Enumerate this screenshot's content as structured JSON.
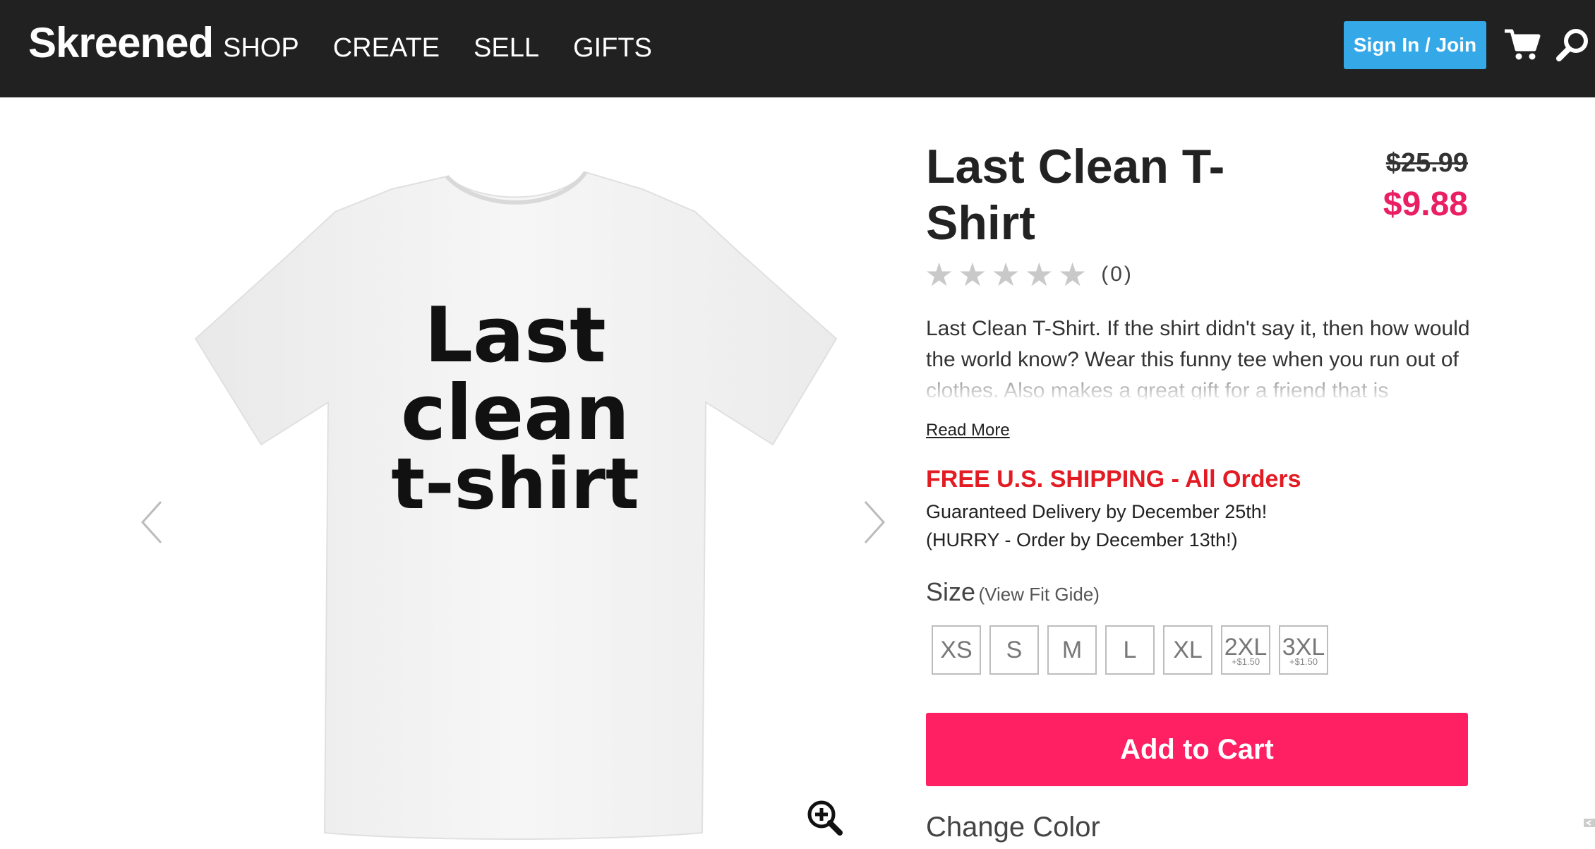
{
  "header": {
    "logo": "Skreened",
    "nav": [
      "SHOP",
      "CREATE",
      "SELL",
      "GIFTS"
    ],
    "signin_label": "Sign In / Join",
    "cart_icon": "cart-icon",
    "search_icon": "search-icon"
  },
  "product": {
    "shirt_text": [
      "Last",
      "clean",
      "t-shirt"
    ],
    "title": "Last Clean T-Shirt",
    "price_old": "$25.99",
    "price_new": "$9.88",
    "rating": {
      "stars": 0,
      "max": 5,
      "count_label": "(0)"
    },
    "description": "Last Clean T-Shirt. If the shirt didn't say it, then how would the world know? Wear this funny tee when you run out of clothes. Also makes a great gift for a friend that is",
    "read_more": "Read More",
    "shipping": {
      "title": "FREE U.S. SHIPPING - All Orders",
      "line1": "Guaranteed Delivery by December 25th!",
      "line2": "(HURRY - Order by December 13th!)"
    },
    "size_label": "Size",
    "fit_guide": "(View Fit Gide)",
    "sizes": [
      {
        "label": "XS",
        "surcharge": ""
      },
      {
        "label": "S",
        "surcharge": ""
      },
      {
        "label": "M",
        "surcharge": ""
      },
      {
        "label": "L",
        "surcharge": ""
      },
      {
        "label": "XL",
        "surcharge": ""
      },
      {
        "label": "2XL",
        "surcharge": "+$1.50"
      },
      {
        "label": "3XL",
        "surcharge": "+$1.50"
      }
    ],
    "add_to_cart": "Add to Cart",
    "change_color": "Change Color"
  },
  "colors": {
    "header_bg": "#212121",
    "signin_bg": "#35a9e8",
    "sale_price": "#e91e63",
    "shipping_red": "#e31b23",
    "add_to_cart_bg": "#ff1f63"
  }
}
